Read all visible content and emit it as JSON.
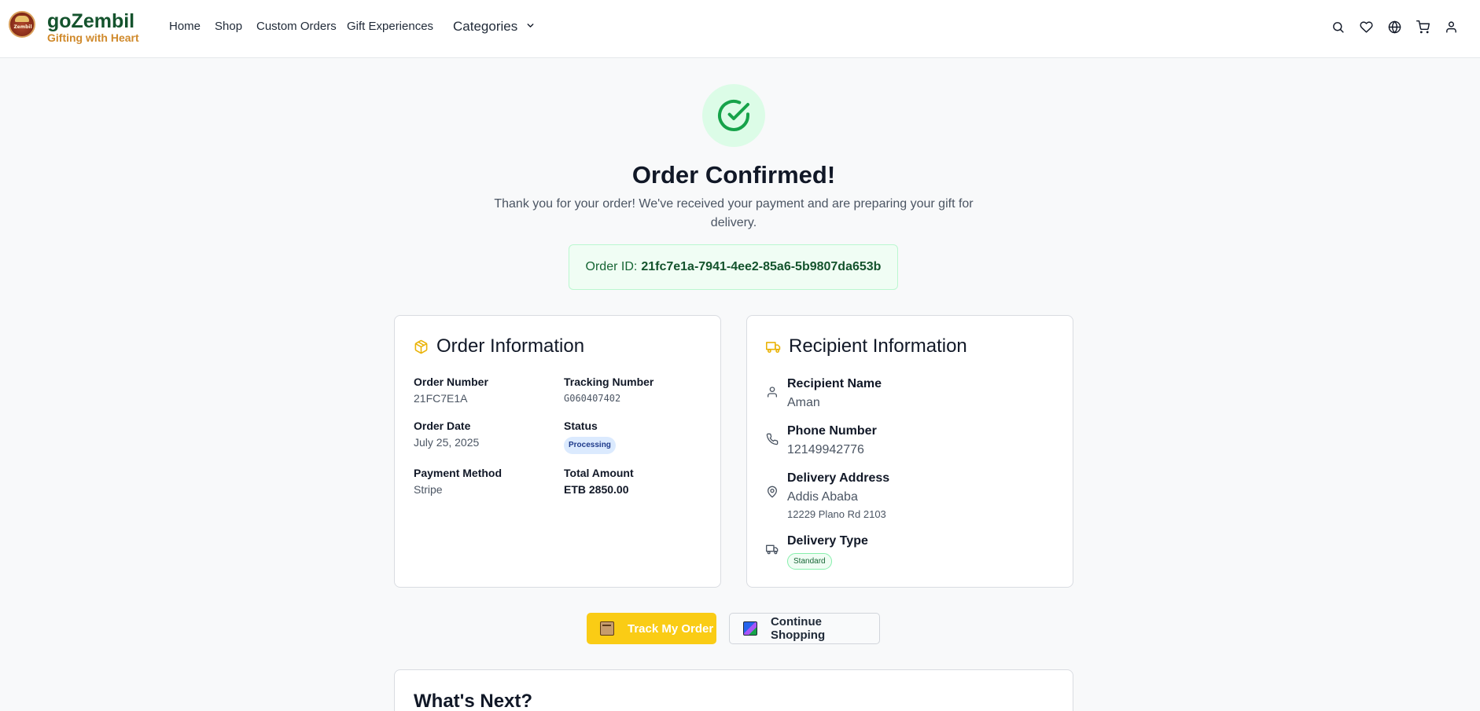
{
  "header": {
    "logo_text": "Zembil",
    "brand": "goZembil",
    "tagline": "Gifting with Heart",
    "nav": [
      "Home",
      "Shop",
      "Custom Orders",
      "Gift Experiences"
    ],
    "categories": "Categories",
    "icons": [
      "search-icon",
      "heart-icon",
      "globe-icon",
      "cart-icon",
      "user-icon"
    ]
  },
  "confirmation": {
    "title": "Order Confirmed!",
    "subtitle": "Thank you for your order! We've received your payment and are preparing your gift for delivery.",
    "order_id_label": "Order ID:",
    "order_id": "21fc7e1a-7941-4ee2-85a6-5b9807da653b"
  },
  "order_info": {
    "title": "Order Information",
    "order_number_label": "Order Number",
    "order_number": "21FC7E1A",
    "tracking_label": "Tracking Number",
    "tracking_number": "G060407402",
    "order_date_label": "Order Date",
    "order_date": "July 25, 2025",
    "status_label": "Status",
    "status": "Processing",
    "payment_label": "Payment Method",
    "payment": "Stripe",
    "total_label": "Total Amount",
    "total": "ETB 2850.00"
  },
  "recipient": {
    "title": "Recipient Information",
    "name_label": "Recipient Name",
    "name": "Aman",
    "phone_label": "Phone Number",
    "phone": "12149942776",
    "address_label": "Delivery Address",
    "city": "Addis Ababa",
    "street": "12229 Plano Rd 2103",
    "delivery_label": "Delivery Type",
    "delivery_type": "Standard"
  },
  "actions": {
    "track": "Track My Order",
    "continue": "Continue Shopping"
  },
  "next": {
    "title": "What's Next?"
  },
  "colors": {
    "brand_green": "#14532d",
    "tagline_orange": "#d08a2c",
    "accent_yellow": "#facc15",
    "success_green": "#16a34a"
  }
}
